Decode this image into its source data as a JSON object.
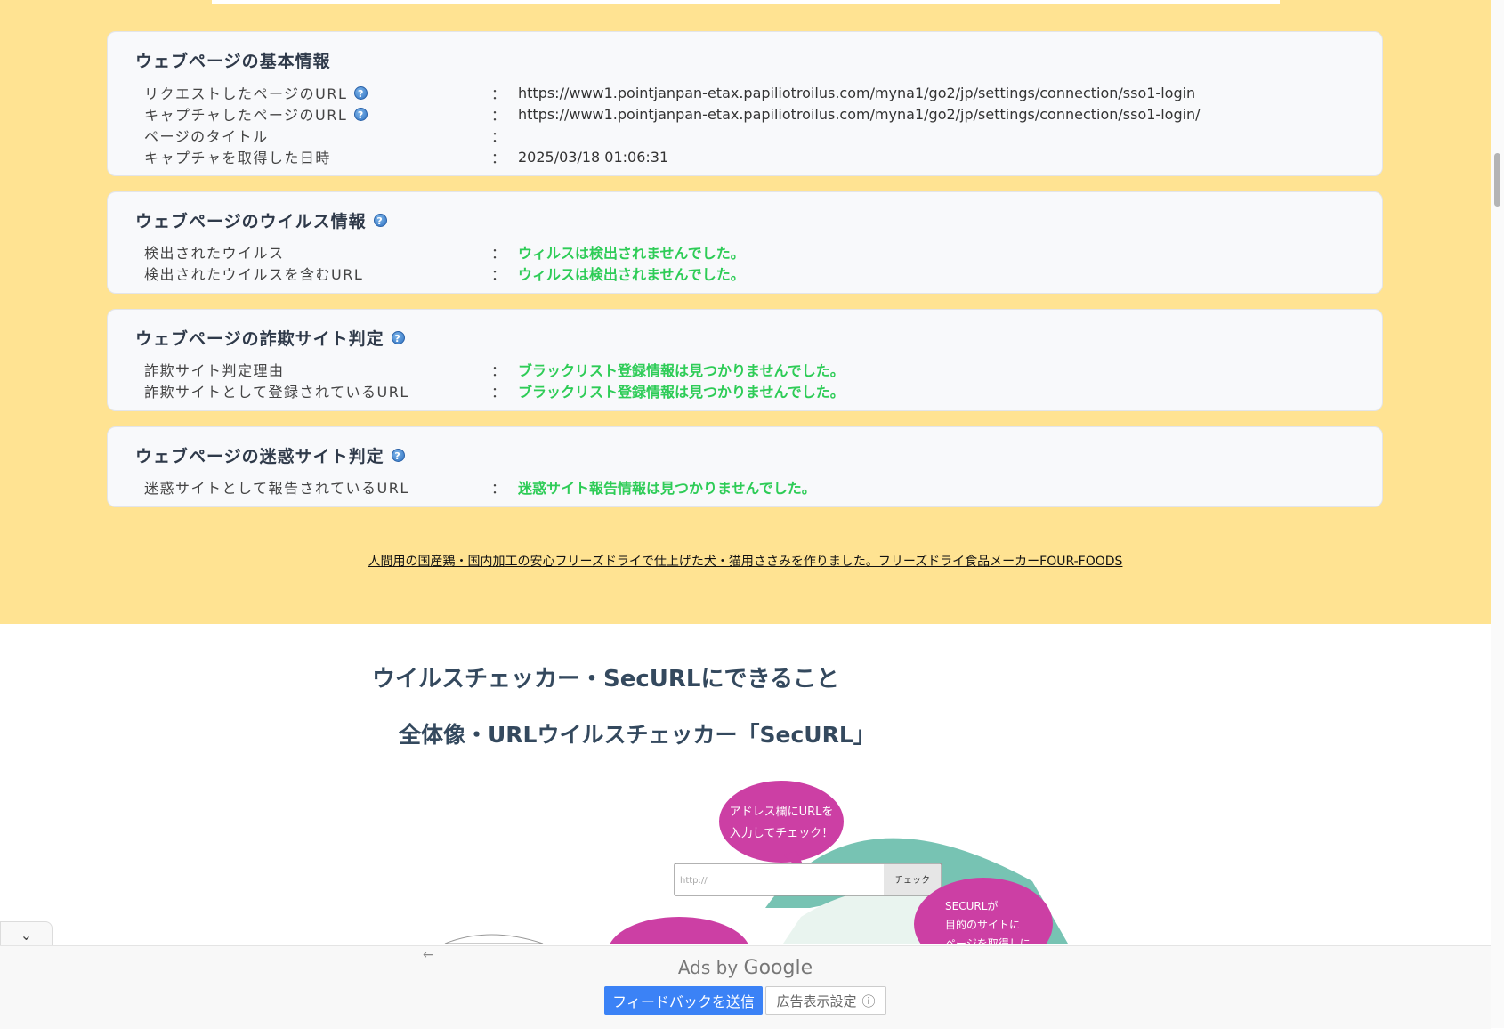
{
  "basic_info": {
    "title": "ウェブページの基本情報",
    "rows": [
      {
        "label": "リクエストしたページのURL",
        "value": "https://www1.pointjanpan-etax.papiliotroilus.com/myna1/go2/jp/settings/connection/sso1-login"
      },
      {
        "label": "キャプチャしたページのURL",
        "value": "https://www1.pointjanpan-etax.papiliotroilus.com/myna1/go2/jp/settings/connection/sso1-login/"
      },
      {
        "label": "ページのタイトル",
        "value": ""
      },
      {
        "label": "キャプチャを取得した日時",
        "value": "2025/03/18 01:06:31"
      }
    ]
  },
  "virus_info": {
    "title": "ウェブページのウイルス情報",
    "rows": [
      {
        "label": "検出されたウイルス",
        "value": "ウィルスは検出されませんでした。"
      },
      {
        "label": "検出されたウイルスを含むURL",
        "value": "ウィルスは検出されませんでした。"
      }
    ]
  },
  "fraud_info": {
    "title": "ウェブページの詐欺サイト判定",
    "rows": [
      {
        "label": "詐欺サイト判定理由",
        "value": "ブラックリスト登録情報は見つかりませんでした。"
      },
      {
        "label": "詐欺サイトとして登録されているURL",
        "value": "ブラックリスト登録情報は見つかりませんでした。"
      }
    ]
  },
  "nuisance_info": {
    "title": "ウェブページの迷惑サイト判定",
    "rows": [
      {
        "label": "迷惑サイトとして報告されているURL",
        "value": "迷惑サイト報告情報は見つかりませんでした。"
      }
    ]
  },
  "colon": "：",
  "help_glyph": "?",
  "footer_link": "人間用の国産鶏・国内加工の安心フリーズドライで仕上げた犬・猫用ささみを作りました。フリーズドライ食品メーカーFOUR-FOODS",
  "section": {
    "heading": "ウイルスチェッカー・SecURLにできること",
    "subheading": "全体像・URLウイルスチェッカー「SecURL」"
  },
  "illustration": {
    "bubble1_line1": "アドレス欄にURLを",
    "bubble1_line2": "入力してチェック！",
    "input_placeholder": "http://",
    "check_button": "チェック",
    "bubble2_line1": "SECURLが",
    "bubble2_line2": "目的のサイトに",
    "bubble2_line3": "ページを取得しに"
  },
  "ads": {
    "ads_by": "Ads by",
    "google": "Google",
    "feedback_button": "フィードバックを送信",
    "ad_settings_button": "広告表示設定",
    "info_icon": "ⓘ",
    "collapse_icon": "⌄",
    "back_icon": "←"
  },
  "colors": {
    "background_yellow": "#ffe392",
    "ok_green": "#2ecc57",
    "heading": "#34495e",
    "teal": "#5fb8a6",
    "magenta": "#cc3fa4",
    "feedback_blue": "#3b82f6"
  }
}
